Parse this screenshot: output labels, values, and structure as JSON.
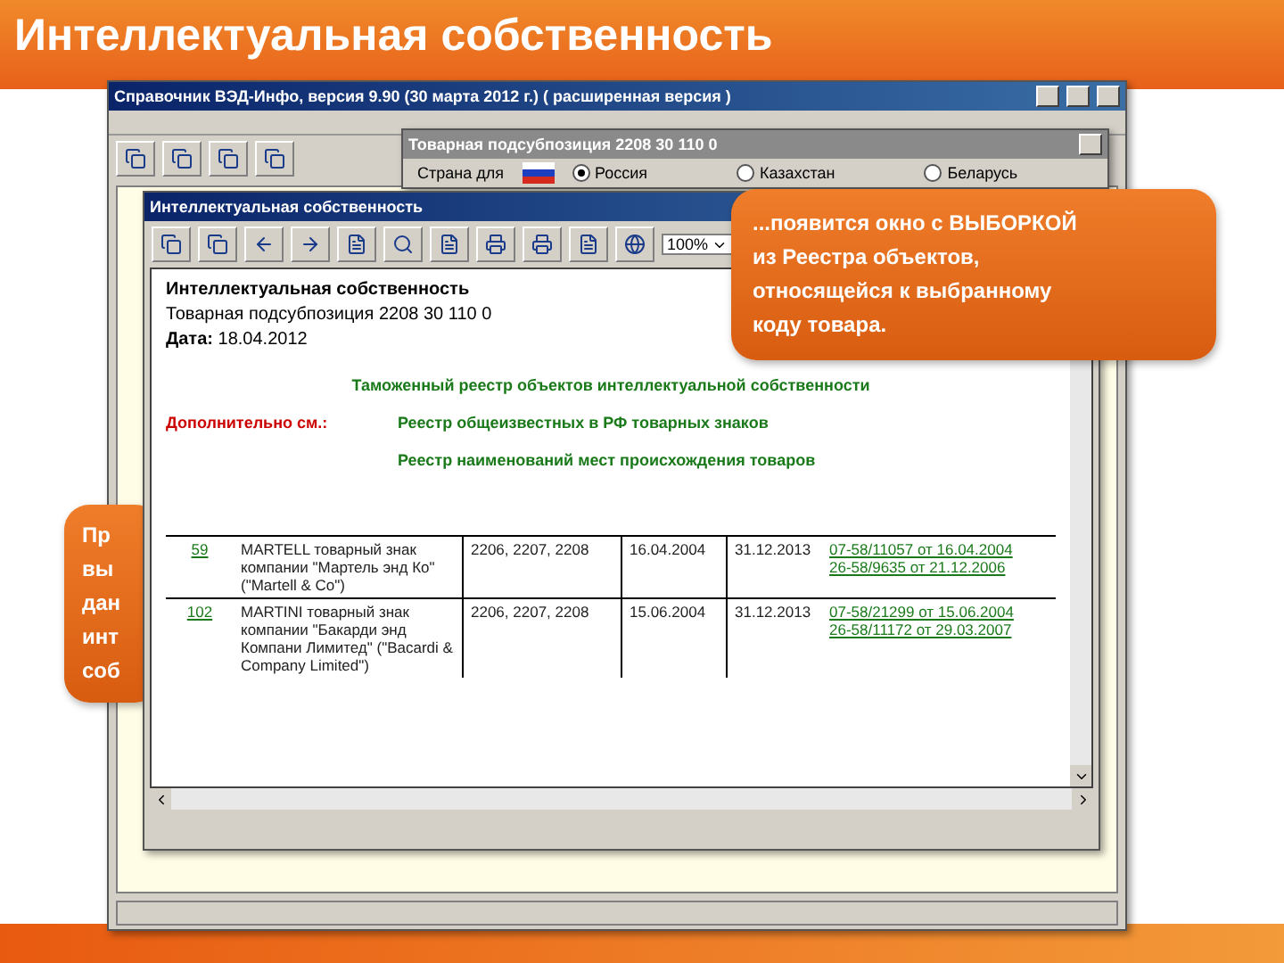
{
  "slide": {
    "title": "Интеллектуальная собственность"
  },
  "main_window": {
    "title": "Справочник ВЭД-Инфо, версия 9.90 (30 марта 2012 г.) ( расширенная версия )"
  },
  "subheading_window": {
    "title": "Товарная подсубпозиция 2208 30 110 0",
    "country_label": "Страна для",
    "countries": [
      {
        "label": "Россия",
        "selected": true
      },
      {
        "label": "Казахстан",
        "selected": false
      },
      {
        "label": "Беларусь",
        "selected": false
      }
    ]
  },
  "ip_window": {
    "title": "Интеллектуальная собственность",
    "zoom": "100%",
    "heading": "Интеллектуальная собственность",
    "subheading": "Товарная подсубпозиция 2208 30 110 0",
    "date": "**Дата:** 18.04.2012",
    "registry_link": "Таможенный реестр объектов интеллектуальной собственности",
    "see_also_label": "Дополнительно см.:",
    "see_also": [
      "Реестр общеизвестных в РФ товарных знаков",
      "Реестр наименований мест происхождения товаров"
    ],
    "rows": [
      {
        "number": "59",
        "name": "MARTELL товарный знак компании \"Мартель энд Ко\" (\"Martell & Co\")",
        "codes": "2206, 2207, 2208",
        "registered": "16.04.2004",
        "valid_until": "31.12.2013",
        "letters": [
          "07-58/11057 от 16.04.2004",
          "26-58/9635 от 21.12.2006"
        ]
      },
      {
        "number": "102",
        "name": "MARTINI товарный знак компании \"Бакарди энд Компани Лимитед\" (\"Bacardi & Company Limited\")",
        "codes": "2206, 2207, 2208",
        "registered": "15.06.2004",
        "valid_until": "31.12.2013",
        "letters": [
          "07-58/21299 от 15.06.2004",
          "26-58/11172 от 29.03.2007"
        ]
      }
    ]
  },
  "left_callout": {
    "lines": [
      "Пр",
      "вы",
      "дан",
      "инт",
      "соб"
    ]
  },
  "right_callout": {
    "lines": [
      "...появится окно с ВЫБОРКОЙ",
      "из Реестра объектов,",
      "относящейся к выбранному",
      "коду товара."
    ]
  }
}
